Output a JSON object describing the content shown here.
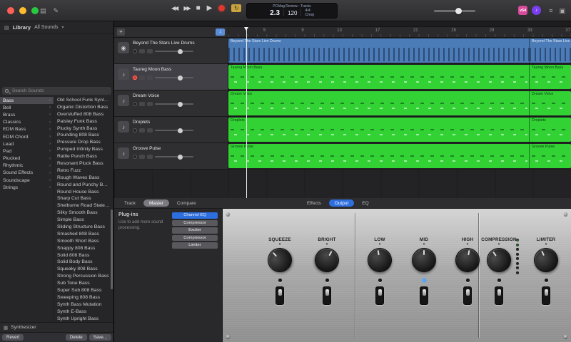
{
  "colors": {
    "accent_blue": "#2e6fe0",
    "region_green": "#32d235",
    "region_blue": "#4c7cb8",
    "record_red": "#e0382e",
    "led_blue": "#4aa3ff"
  },
  "toolbar": {
    "left_icons": [
      {
        "glyph": "▤"
      },
      {
        "glyph": "✎"
      }
    ],
    "transport": {
      "rewind": "◀◀",
      "forward": "▶▶",
      "stop": "■",
      "play": "▶",
      "cycle": "↻"
    },
    "lcd": {
      "title": "PCMag Review - Tracks",
      "title_chevron": "▾",
      "position": "2.3",
      "tempo": "120",
      "time_signature": "4/4",
      "key": "Cmaj"
    },
    "badges": [
      {
        "label": "v54"
      },
      {
        "label": "♪"
      }
    ],
    "right_icons": [
      {
        "glyph": "≡"
      },
      {
        "glyph": "▣"
      }
    ]
  },
  "library": {
    "title": "Library",
    "scope": "All Sounds",
    "scope_chevron": "▾",
    "media_icon": "▤",
    "category_chevron": "›",
    "search_placeholder": "Search Sounds",
    "categories": [
      {
        "label": "Bass",
        "selected": true
      },
      {
        "label": "Bell"
      },
      {
        "label": "Brass"
      },
      {
        "label": "Classics"
      },
      {
        "label": "EDM Bass"
      },
      {
        "label": "EDM Chord"
      },
      {
        "label": "Lead"
      },
      {
        "label": "Pad"
      },
      {
        "label": "Plucked"
      },
      {
        "label": "Rhythmic"
      },
      {
        "label": "Sound Effects"
      },
      {
        "label": "Soundscape"
      },
      {
        "label": "Strings"
      }
    ],
    "sounds": [
      "Old School Funk Synth B...",
      "Organic Distortion Bass",
      "Overstuffed 808 Bass",
      "Paisley Funk Bass",
      "Plucky Synth Bass",
      "Pounding 808 Bass",
      "Pressure Drop Bass",
      "Pumped Infinity Bass",
      "Rattle Punch Bass",
      "Resonant Pluck Bass",
      "Retro Fuzz",
      "Rough Waves Bass",
      "Round and Punchy Bass",
      "Round House Bass",
      "Sharp Cut Bass",
      "Shelburne Road State Ba...",
      "Silky Smooth Bass",
      "Simple Bass",
      "Sliding Structure Bass",
      "Smashed 808 Bass",
      "Smooth Short Bass",
      "Snappy 808 Bass",
      "Solid 808 Bass",
      "Solid Body Bass",
      "Squeaky 808 Bass",
      "Strong Percussion Bass",
      "Sub Tone Bass",
      "Super Sub 808 Bass",
      "Sweeping 808 Bass",
      "Synth Bass Mutation",
      "Synth E-Bass",
      "Synth Upright Bass"
    ],
    "instrument_icon": "▦",
    "instrument_type": "Synthesizer",
    "footer_buttons": [
      {
        "label": "Revert"
      },
      {
        "label": "Delete"
      },
      {
        "label": "Save..."
      }
    ]
  },
  "workspace": {
    "add_track_label": "+",
    "catch_glyph": "↓",
    "ruler_marks": [
      "5",
      "9",
      "13",
      "17",
      "21",
      "25",
      "29",
      "33",
      "37"
    ],
    "tracks": [
      {
        "name": "Beyond The Stars Live Drums",
        "color": "blue",
        "icon": "◉",
        "rec": "rec-off"
      },
      {
        "name": "Taureg Moon Bass",
        "color": "green",
        "icon": "♪",
        "rec": "rec-on",
        "selected": true
      },
      {
        "name": "Dream Voice",
        "color": "green",
        "icon": "♪",
        "rec": "rec-off"
      },
      {
        "name": "Droplets",
        "color": "green",
        "icon": "♪",
        "rec": "rec-off"
      },
      {
        "name": "Groove Pulse",
        "color": "green",
        "icon": "♪",
        "rec": "rec-off"
      }
    ]
  },
  "smart_controls": {
    "knob_marker": "▾",
    "left_tabs": [
      {
        "label": "Track"
      },
      {
        "label": "Master",
        "selected": true
      },
      {
        "label": "Compare"
      }
    ],
    "right_tabs": [
      {
        "label": "Effects"
      },
      {
        "label": "Output",
        "selected": true
      },
      {
        "label": "EQ"
      }
    ],
    "plugins": {
      "title": "Plug-ins",
      "hint": "Use to add more sound processing.",
      "items": [
        {
          "label": "Channel EQ",
          "selected": true
        },
        {
          "label": "Compressor"
        },
        {
          "label": "Exciter"
        },
        {
          "label": "Compressor"
        },
        {
          "label": "Limiter"
        }
      ]
    },
    "knobs": [
      {
        "label": "SQUEEZE",
        "led": "led-off"
      },
      {
        "label": "BRIGHT",
        "led": "led-off"
      },
      {
        "label": "LOW",
        "led": "led-off"
      },
      {
        "label": "MID",
        "led": "led-on"
      },
      {
        "label": "HIGH",
        "led": "led-off"
      },
      {
        "label": "COMPRESSION",
        "led": "led-off"
      },
      {
        "label": "LIMITER",
        "led": "led-off"
      }
    ]
  }
}
